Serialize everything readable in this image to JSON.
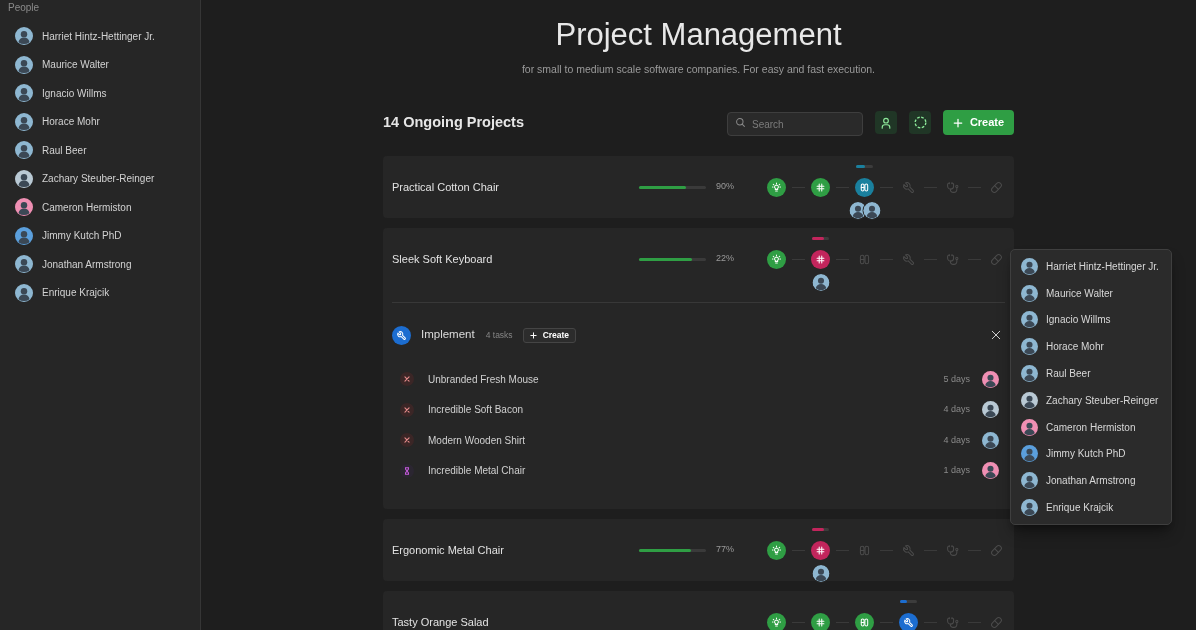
{
  "sidebar": {
    "heading": "People",
    "people": [
      {
        "name": "Harriet Hintz-Hettinger Jr.",
        "color": "#8eb7d1"
      },
      {
        "name": "Maurice Walter",
        "color": "#8eb7d1"
      },
      {
        "name": "Ignacio Willms",
        "color": "#8eb7d1"
      },
      {
        "name": "Horace Mohr",
        "color": "#8eb7d1"
      },
      {
        "name": "Raul Beer",
        "color": "#8eb7d1"
      },
      {
        "name": "Zachary Steuber-Reinger",
        "color": "#b9c9d4"
      },
      {
        "name": "Cameron Hermiston",
        "color": "#ef8fb3"
      },
      {
        "name": "Jimmy Kutch PhD",
        "color": "#5b9fdc"
      },
      {
        "name": "Jonathan Armstrong",
        "color": "#8eb7d1"
      },
      {
        "name": "Enrique Krajcik",
        "color": "#8eb7d1"
      }
    ]
  },
  "header": {
    "title": "Project Management",
    "subtitle": "for small to medium scale software companies. For easy and fast execution."
  },
  "toolbar": {
    "heading": "14 Ongoing Projects",
    "search": {
      "placeholder": "Search"
    },
    "create_button": {
      "label": "Create"
    }
  },
  "projects": [
    {
      "name": "Practical Cotton Chair",
      "level": 0.7,
      "reading": "90%",
      "expanded": false,
      "stages": [
        {
          "kind": "idea",
          "done": true,
          "active": false
        },
        {
          "kind": "design",
          "done": true,
          "active": false
        },
        {
          "kind": "build",
          "done": false,
          "active": true,
          "level": 0.55,
          "assignees": [
            {
              "color": "#8eb7d1"
            },
            {
              "color": "#8eb7d1"
            }
          ]
        },
        {
          "kind": "implement",
          "done": false,
          "active": false
        },
        {
          "kind": "test",
          "done": false,
          "active": false
        },
        {
          "kind": "deploy",
          "done": false,
          "active": false
        }
      ]
    },
    {
      "name": "Sleek Soft Keyboard",
      "level": 0.79,
      "reading": "22%",
      "expanded": true,
      "stages": [
        {
          "kind": "idea",
          "done": true,
          "active": false
        },
        {
          "kind": "design",
          "done": false,
          "active": true,
          "level": 0.7,
          "assignees": [
            {
              "color": "#8eb7d1"
            }
          ]
        },
        {
          "kind": "build",
          "done": false,
          "active": false
        },
        {
          "kind": "implement",
          "done": false,
          "active": false
        },
        {
          "kind": "test",
          "done": false,
          "active": false
        },
        {
          "kind": "deploy",
          "done": false,
          "active": false
        }
      ],
      "panel": {
        "kind": "implement",
        "title": "Implement",
        "count": "4 tasks",
        "create_button": {
          "label": "Create"
        },
        "tasks": [
          {
            "name": "Unbranded Fresh Mouse",
            "kind": "failed",
            "due": "5 days",
            "assignee": {
              "color": "#ef8fb3"
            }
          },
          {
            "name": "Incredible Soft Bacon",
            "kind": "failed",
            "due": "4 days",
            "assignee": {
              "color": "#b9c9d4"
            }
          },
          {
            "name": "Modern Wooden Shirt",
            "kind": "failed",
            "due": "4 days",
            "assignee": {
              "color": "#8eb7d1"
            }
          },
          {
            "name": "Incredible Metal Chair",
            "kind": "waiting",
            "due": "1 days",
            "assignee": {
              "color": "#ef8fb3"
            }
          }
        ]
      }
    },
    {
      "name": "Ergonomic Metal Chair",
      "level": 0.77,
      "reading": "77%",
      "expanded": false,
      "stages": [
        {
          "kind": "idea",
          "done": true,
          "active": false
        },
        {
          "kind": "design",
          "done": false,
          "active": true,
          "level": 0.7,
          "assignees": [
            {
              "color": "#8eb7d1"
            }
          ]
        },
        {
          "kind": "build",
          "done": false,
          "active": false
        },
        {
          "kind": "implement",
          "done": false,
          "active": false
        },
        {
          "kind": "test",
          "done": false,
          "active": false
        },
        {
          "kind": "deploy",
          "done": false,
          "active": false
        }
      ]
    },
    {
      "name": "Tasty Orange Salad",
      "expanded": false,
      "stages": [
        {
          "kind": "idea",
          "done": true,
          "active": false
        },
        {
          "kind": "design",
          "done": true,
          "active": false
        },
        {
          "kind": "build",
          "done": true,
          "active": false
        },
        {
          "kind": "implement",
          "done": false,
          "active": true,
          "level": 0.4
        },
        {
          "kind": "test",
          "done": false,
          "active": false
        },
        {
          "kind": "deploy",
          "done": false,
          "active": false
        }
      ]
    }
  ],
  "assignee_menu": {
    "people": [
      {
        "name": "Harriet Hintz-Hettinger Jr.",
        "color": "#8eb7d1"
      },
      {
        "name": "Maurice Walter",
        "color": "#8eb7d1"
      },
      {
        "name": "Ignacio Willms",
        "color": "#8eb7d1"
      },
      {
        "name": "Horace Mohr",
        "color": "#8eb7d1"
      },
      {
        "name": "Raul Beer",
        "color": "#8eb7d1"
      },
      {
        "name": "Zachary Steuber-Reinger",
        "color": "#b9c9d4"
      },
      {
        "name": "Cameron Hermiston",
        "color": "#ef8fb3"
      },
      {
        "name": "Jimmy Kutch PhD",
        "color": "#5b9fdc"
      },
      {
        "name": "Jonathan Armstrong",
        "color": "#8eb7d1"
      },
      {
        "name": "Enrique Krajcik",
        "color": "#8eb7d1"
      }
    ]
  }
}
